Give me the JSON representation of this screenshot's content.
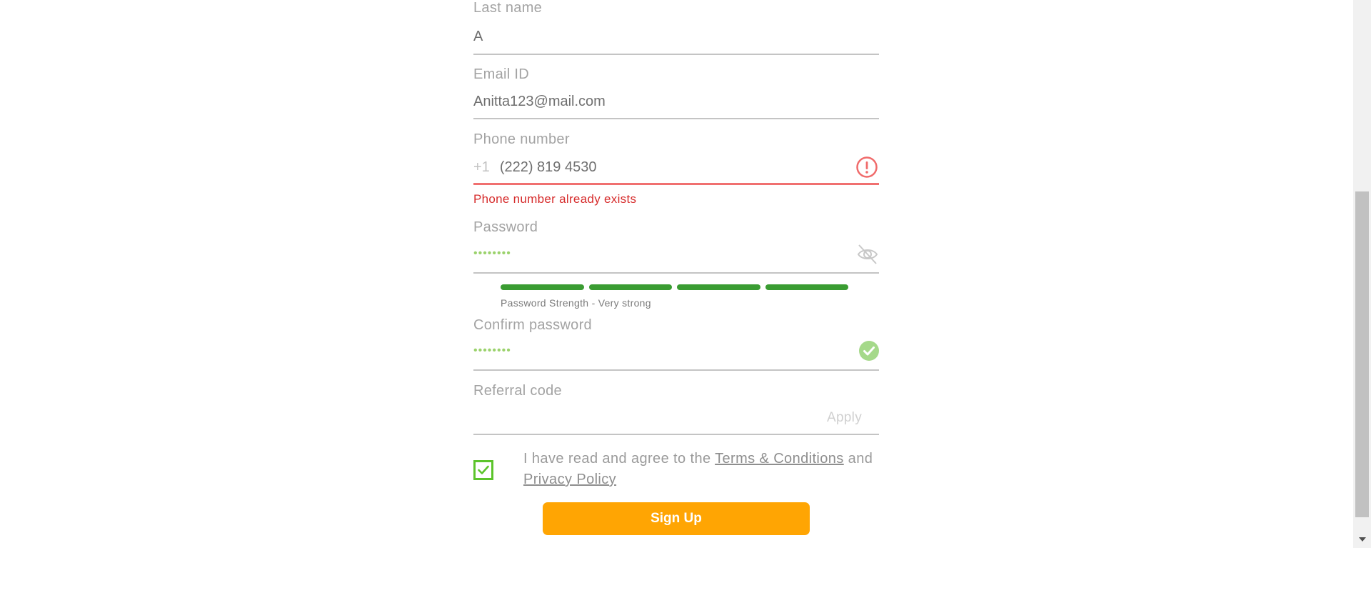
{
  "form": {
    "last_name": {
      "label": "Last name",
      "value": "A"
    },
    "email": {
      "label": "Email ID",
      "value": "Anitta123@mail.com"
    },
    "phone": {
      "label": "Phone number",
      "prefix": "+1",
      "value": "(222) 819 4530",
      "error": "Phone number already exists",
      "error_icon": "error-circle-icon"
    },
    "password": {
      "label": "Password",
      "value": "••••••••",
      "toggle_icon": "eye-hidden-icon",
      "strength_text": "Password Strength - Very strong",
      "strength_level": 4,
      "strength_max": 4
    },
    "confirm_password": {
      "label": "Confirm password",
      "value": "••••••••",
      "status_icon": "check-circle-icon"
    },
    "referral": {
      "label": "Referral code",
      "value": "",
      "apply_label": "Apply"
    },
    "agreement": {
      "checked": true,
      "text_before": "I have read and agree to the ",
      "terms_link": "Terms & Conditions",
      "text_middle": " and ",
      "privacy_link": "Privacy Policy"
    },
    "signup_label": "Sign Up"
  },
  "colors": {
    "accent": "#ffa503",
    "error": "#d62b2b",
    "success": "#3a9c32",
    "checkbox": "#5cc42b"
  }
}
